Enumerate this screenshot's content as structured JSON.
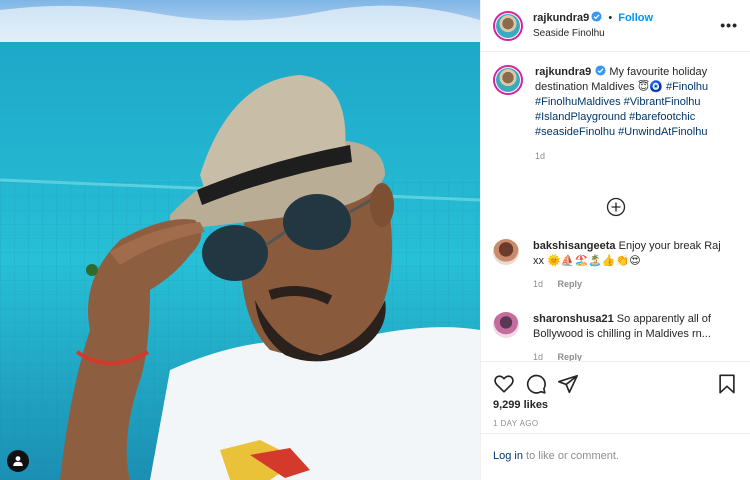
{
  "post": {
    "username": "rajkundra9",
    "follow_label": "Follow",
    "separator": "•",
    "location": "Seaside Finolhu",
    "more_label": "•••"
  },
  "caption": {
    "username": "rajkundra9",
    "text": "My favourite holiday destination Maldives 😇🧿",
    "hashtags": "#Finolhu #FinolhuMaldives #VibrantFinolhu #IslandPlayground #barefootchic #seasideFinolhu #UnwindAtFinolhu",
    "time": "1d"
  },
  "comments": [
    {
      "username": "bakshisangeeta",
      "text": "Enjoy your break Raj xx 🌞⛵🏖️🏝️👍👏😍",
      "time": "1d",
      "reply": "Reply"
    },
    {
      "username": "sharonshusa21",
      "text": "So apparently all of Bollywood is chilling in Maldives rn...",
      "time": "1d",
      "reply": "Reply"
    }
  ],
  "likes": "9,299 likes",
  "posted_ago": "1 DAY AGO",
  "login": {
    "link": "Log in",
    "rest": "to like or comment."
  },
  "icons": [
    "heart-icon",
    "comment-icon",
    "share-icon",
    "bookmark-icon",
    "add-circle-icon",
    "user-tag-icon",
    "verified-icon"
  ],
  "colors": {
    "accent": "#0095f6",
    "hashtag": "#00376b",
    "muted": "#8e8e8e",
    "water": "#2ab6c9"
  }
}
